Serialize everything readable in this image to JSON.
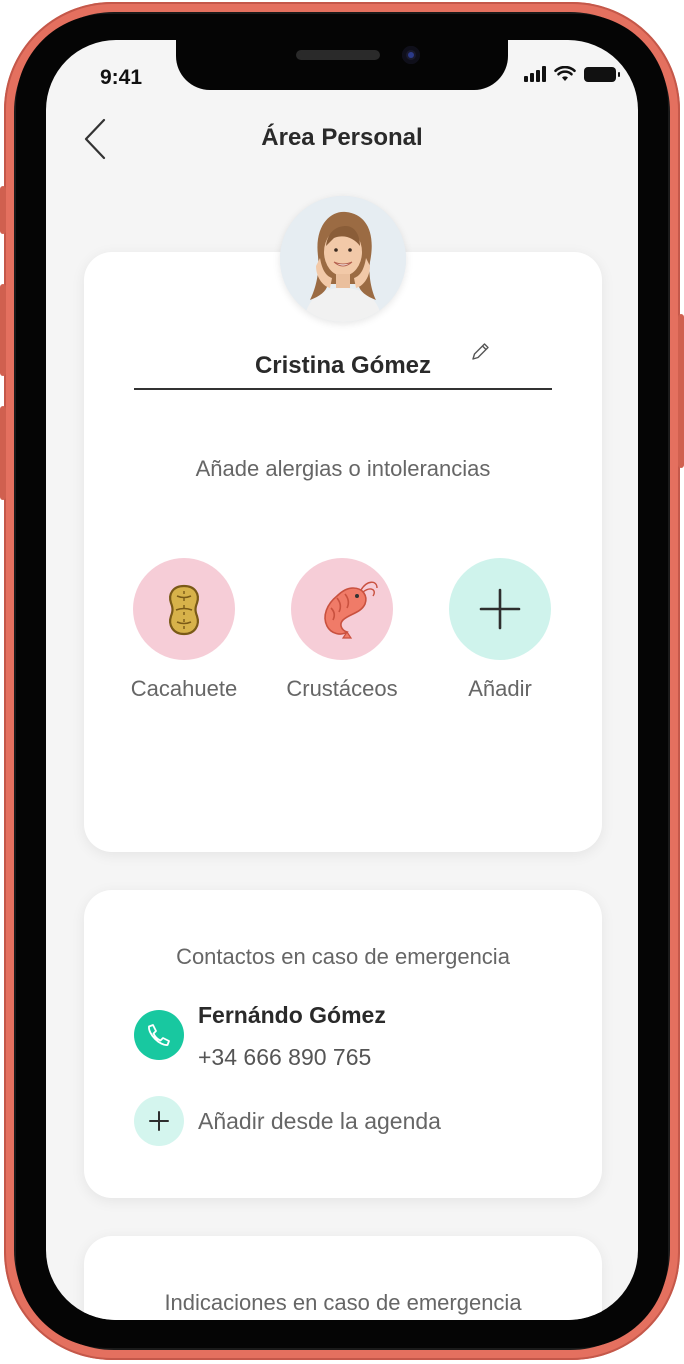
{
  "status_bar": {
    "time": "9:41"
  },
  "nav": {
    "title": "Área Personal",
    "back_icon": "chevron-left-icon"
  },
  "profile": {
    "name": "Cristina Gómez",
    "edit_icon": "pencil-icon",
    "allergies_prompt": "Añade alergias o intolerancias",
    "allergies": [
      {
        "label": "Cacahuete",
        "icon": "peanut-icon",
        "bg": "#f6cdd7"
      },
      {
        "label": "Crustáceos",
        "icon": "shrimp-icon",
        "bg": "#f6cdd7"
      },
      {
        "label": "Añadir",
        "icon": "plus-icon",
        "bg": "#cff3ec"
      }
    ]
  },
  "contacts": {
    "title": "Contactos en caso de emergencia",
    "items": [
      {
        "name": "Fernándo Gómez",
        "phone": "+34 666 890 765",
        "icon": "phone-icon"
      }
    ],
    "add_label": "Añadir desde la agenda",
    "add_icon": "plus-icon"
  },
  "instructions": {
    "title": "Indicaciones en caso de emergencia"
  },
  "colors": {
    "accent": "#18c8a0",
    "accent_light": "#cff3ec",
    "allergy_pink": "#f6cdd7",
    "phone_frame": "#e4705f"
  }
}
